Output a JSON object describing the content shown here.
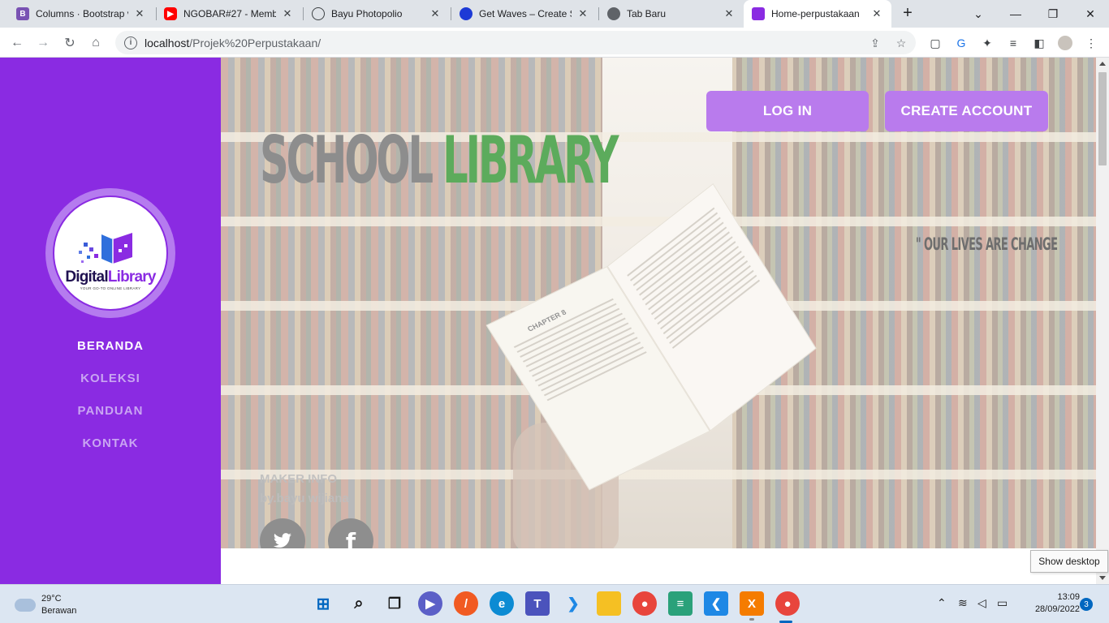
{
  "browser": {
    "tabs": [
      {
        "title": "Columns · Bootstrap v",
        "icon": "bootstrap-icon",
        "color": "#7952b3"
      },
      {
        "title": "NGOBAR#27 - Memb",
        "icon": "youtube-icon",
        "color": "#ff0000"
      },
      {
        "title": "Bayu Photopolio",
        "icon": "globe-icon",
        "color": "#5f6368"
      },
      {
        "title": "Get Waves – Create SV",
        "icon": "getwaves-icon",
        "color": "#1d3ad6"
      },
      {
        "title": "Tab Baru",
        "icon": "chrome-icon",
        "color": "#5f6368"
      },
      {
        "title": "Home-perpustakaan",
        "icon": "library-icon",
        "color": "#8a2be2"
      }
    ],
    "url_host": "localhost",
    "url_path": "/Projek%20Perpustakaan/"
  },
  "page": {
    "sidebar": {
      "logo_word1": "Digital",
      "logo_word2": "Library",
      "logo_tagline": "YOUR GO-TO ONLINE LIBRARY",
      "menu": [
        {
          "label": "BERANDA"
        },
        {
          "label": "KOLEKSI"
        },
        {
          "label": "PANDUAN"
        },
        {
          "label": "KONTAK"
        }
      ]
    },
    "hero": {
      "title_word1": "SCHOOL",
      "title_word2": "LIBRARY",
      "quote": "\" OUR LIVES ARE CHANGE",
      "login_label": "LOG IN",
      "create_label": "CREATE ACCOUNT",
      "book_chapter": "CHAPTER 8",
      "maker_title": "MAKER INFO",
      "maker_name": "by.bayu wijiana",
      "social": [
        "twitter-icon",
        "facebook-icon"
      ]
    },
    "accent_color": "#8a2be2",
    "button_color": "#b97bed",
    "title_green": "#5cab5c"
  },
  "tooltip": "Show desktop",
  "taskbar": {
    "weather_temp": "29°C",
    "weather_desc": "Berawan",
    "time": "13:09",
    "date": "28/09/2022",
    "notifications": "3"
  }
}
